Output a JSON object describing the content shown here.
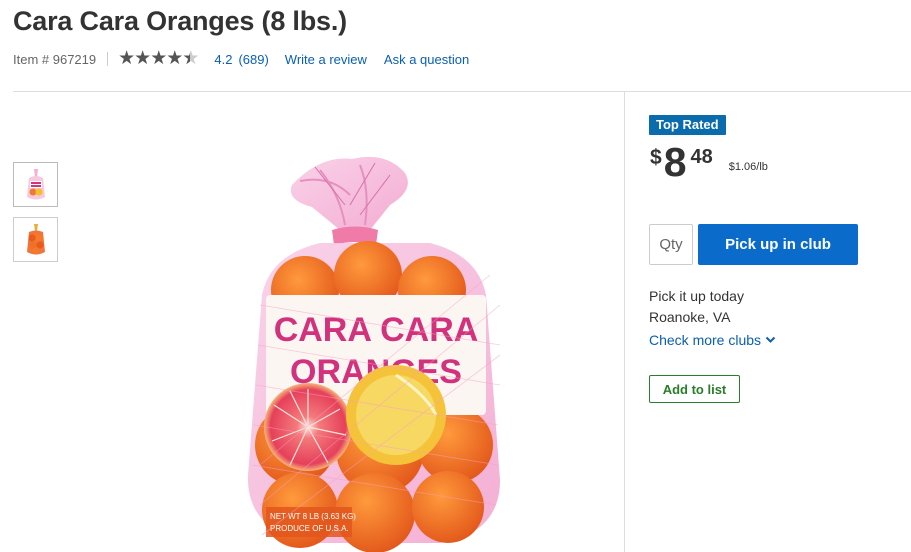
{
  "product": {
    "title": "Cara Cara Oranges (8 lbs.)",
    "item_number": "Item # 967219",
    "rating_value": "4.2",
    "rating_count": "(689)",
    "rating_stars": 4.2,
    "write_review": "Write a review",
    "ask_question": "Ask a question"
  },
  "image": {
    "package_text_line1": "CARA CARA",
    "package_text_line2": "ORANGES",
    "net_wt": "NET WT 8 LB (3.63 KG)",
    "origin": "PRODUCE OF U.S.A."
  },
  "purchase": {
    "badge": "Top Rated",
    "currency": "$",
    "price_dollars": "8",
    "price_cents": "48",
    "unit_price": "$1.06/lb",
    "qty_placeholder": "Qty",
    "pickup_button": "Pick up in club",
    "pickup_heading": "Pick it up today",
    "club_location": "Roanoke, VA",
    "check_more": "Check more clubs",
    "add_to_list": "Add to list"
  },
  "colors": {
    "link": "#0a5fb4",
    "primary_button": "#0a6bcb",
    "badge": "#0a6bad",
    "add_to_list": "#2a7d2a"
  }
}
